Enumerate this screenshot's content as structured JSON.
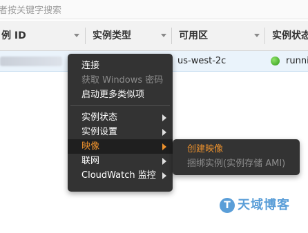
{
  "search": {
    "placeholder": "者按关键字搜索"
  },
  "table": {
    "columns": [
      {
        "label": "例 ID"
      },
      {
        "label": "实例类型"
      },
      {
        "label": "可用区"
      },
      {
        "label": "实例状态"
      }
    ],
    "row": {
      "availability_zone": "us-west-2c",
      "state": "runni",
      "state_color": "#3fb618"
    }
  },
  "context_menu": {
    "items": [
      {
        "label": "连接"
      },
      {
        "label": "获取 Windows 密码",
        "disabled": true
      },
      {
        "label": "启动更多类似项"
      },
      {
        "label": "实例状态",
        "submenu": true
      },
      {
        "label": "实例设置",
        "submenu": true
      },
      {
        "label": "映像",
        "submenu": true,
        "active": true
      },
      {
        "label": "联网",
        "submenu": true
      },
      {
        "label": "CloudWatch 监控",
        "submenu": true
      }
    ],
    "submenu_items": [
      {
        "label": "创建映像",
        "active": true
      },
      {
        "label": "捆绑实例(实例存储 AMI)",
        "disabled": true
      }
    ],
    "active_color": "#ec912d",
    "background_color": "#333333"
  },
  "watermark": {
    "text": "天域博客",
    "color": "#5a9ed8"
  }
}
